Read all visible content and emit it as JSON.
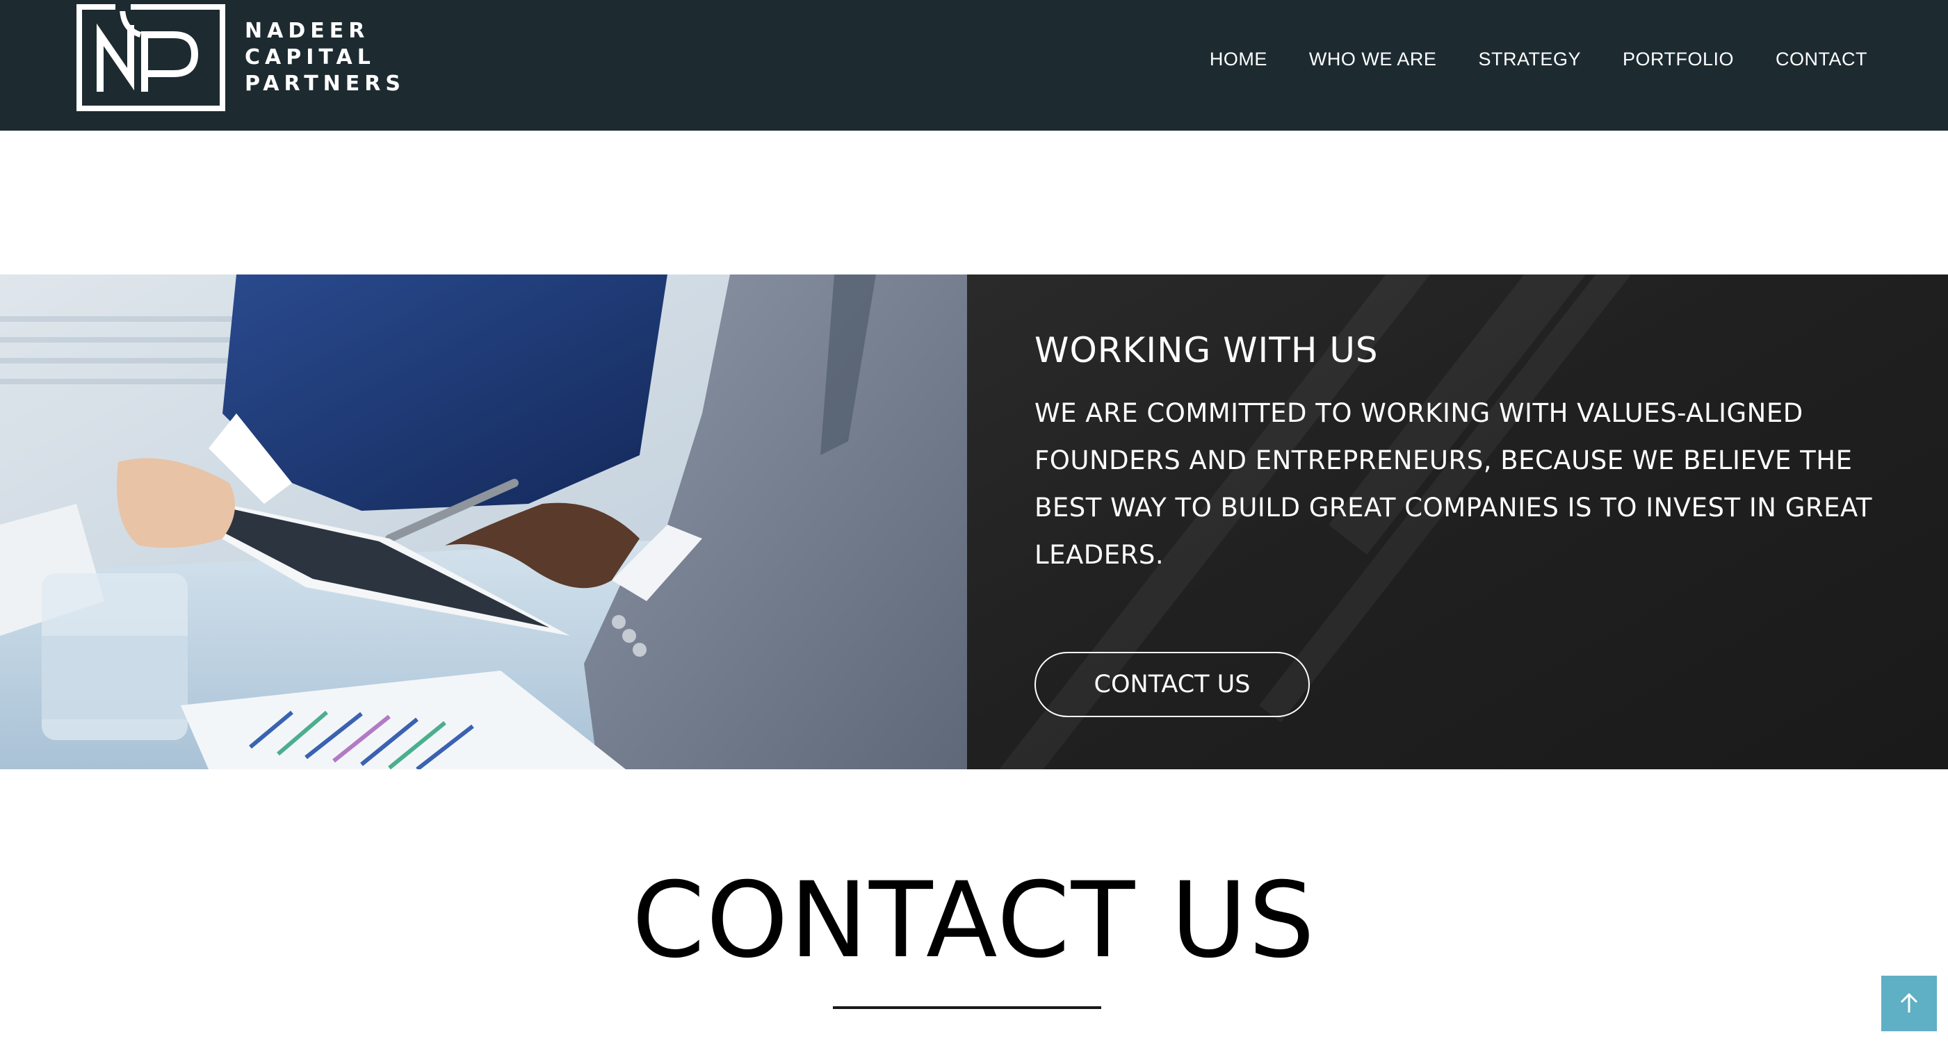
{
  "header": {
    "logo_mark": "NP",
    "logo_lines": [
      "NADEER",
      "CAPITAL",
      "PARTNERS"
    ],
    "nav": [
      {
        "label": "HOME"
      },
      {
        "label": "WHO WE ARE"
      },
      {
        "label": "STRATEGY"
      },
      {
        "label": "PORTFOLIO"
      },
      {
        "label": "CONTACT"
      }
    ]
  },
  "feature": {
    "heading": "WORKING WITH US",
    "text": "WE ARE COMMITTED TO WORKING WITH VALUES-ALIGNED FOUNDERS AND ENTREPRENEURS, BECAUSE WE BELIEVE THE BEST WAY TO BUILD GREAT COMPANIES IS TO INVEST IN GREAT LEADERS.",
    "button_label": "CONTACT US"
  },
  "contact": {
    "title": "CONTACT US"
  },
  "icons": {
    "back_to_top": "arrow-up-icon"
  },
  "colors": {
    "header_bg": "#1d2b31",
    "panel_bg": "#222222",
    "accent": "#5fb0c4"
  }
}
